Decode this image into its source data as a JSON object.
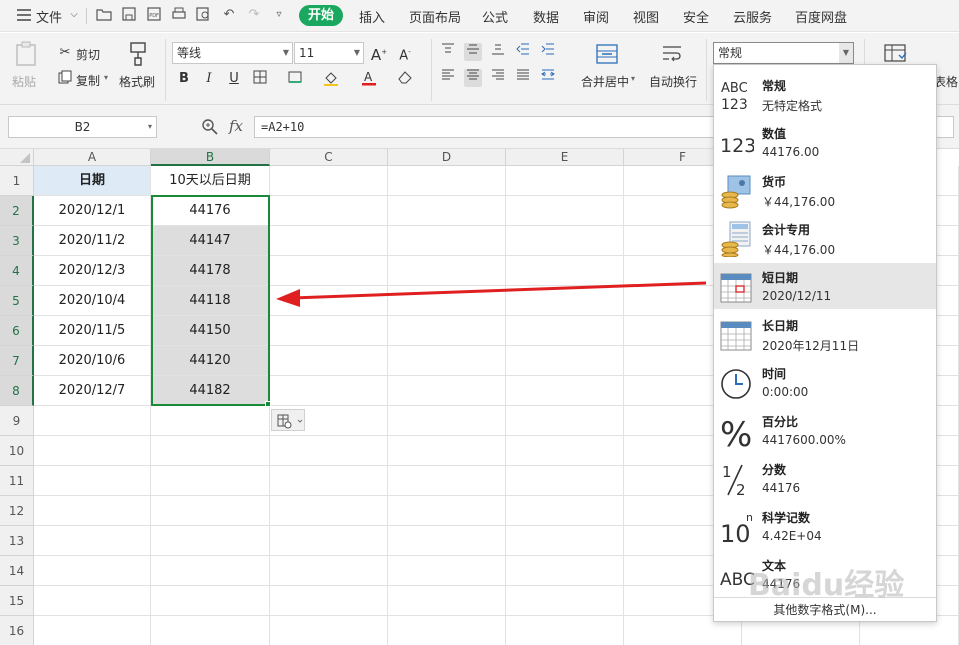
{
  "menubar": {
    "file_label": "文件",
    "tabs": [
      "开始",
      "插入",
      "页面布局",
      "公式",
      "数据",
      "审阅",
      "视图",
      "安全",
      "云服务",
      "百度网盘"
    ]
  },
  "ribbon": {
    "paste_label": "粘贴",
    "cut_label": "剪切",
    "copy_label": "复制",
    "format_painter_label": "格式刷",
    "font_name": "等线",
    "font_size": "11",
    "merge_center_label": "合并居中",
    "wrap_text_label": "自动换行",
    "number_format_value": "常规",
    "table_style_label": "表格"
  },
  "formula_bar": {
    "name_box": "B2",
    "fx_label": "fx",
    "formula": "=A2+10"
  },
  "sheet": {
    "columns": [
      "A",
      "B",
      "C",
      "D",
      "E",
      "F"
    ],
    "rows": [
      "1",
      "2",
      "3",
      "4",
      "5",
      "6",
      "7",
      "8",
      "9",
      "10",
      "11",
      "12",
      "13",
      "14",
      "15",
      "16"
    ],
    "col_a_header": "日期",
    "col_b_header": "10天以后日期",
    "dates": [
      "2020/12/1",
      "2020/11/2",
      "2020/12/3",
      "2020/10/4",
      "2020/11/5",
      "2020/10/6",
      "2020/12/7"
    ],
    "results": [
      "44176",
      "44147",
      "44178",
      "44118",
      "44150",
      "44120",
      "44182"
    ]
  },
  "number_format_dropdown": {
    "items": [
      {
        "name": "常规",
        "example": "无特定格式",
        "icon": "general-abc-icon"
      },
      {
        "name": "数值",
        "example": "44176.00",
        "icon": "number-123-icon"
      },
      {
        "name": "货币",
        "example": "￥44,176.00",
        "icon": "currency-coins-icon"
      },
      {
        "name": "会计专用",
        "example": "￥44,176.00",
        "icon": "accounting-icon"
      },
      {
        "name": "短日期",
        "example": "2020/12/11",
        "icon": "short-date-calendar-icon"
      },
      {
        "name": "长日期",
        "example": "2020年12月11日",
        "icon": "long-date-calendar-icon"
      },
      {
        "name": "时间",
        "example": "0:00:00",
        "icon": "clock-icon"
      },
      {
        "name": "百分比",
        "example": "4417600.00%",
        "icon": "percent-icon"
      },
      {
        "name": "分数",
        "example": "44176",
        "icon": "fraction-icon"
      },
      {
        "name": "科学记数",
        "example": "4.42E+04",
        "icon": "scientific-icon"
      },
      {
        "name": "文本",
        "example": "44176",
        "icon": "text-abc-icon"
      }
    ],
    "more_label": "其他数字格式(M)..."
  },
  "colors": {
    "accent_green": "#1aa860",
    "selection_green": "#217346",
    "header_fill": "#deebf7",
    "arrow_red": "#e02020"
  }
}
